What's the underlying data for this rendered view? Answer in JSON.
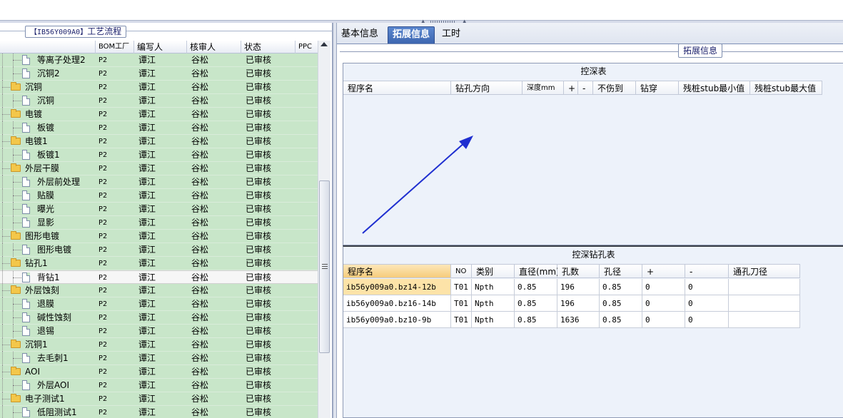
{
  "left_panel": {
    "title_code": "【IB56Y009A0】",
    "title_text": "工艺流程",
    "columns": [
      "BOM工厂",
      "编写人",
      "核审人",
      "状态",
      "PPC"
    ],
    "rows": [
      {
        "name": "等离子处理2",
        "type": "doc",
        "bom": "P2",
        "writer": "谭江",
        "reviewer": "谷松",
        "status": "已审核"
      },
      {
        "name": "沉铜2",
        "type": "doc",
        "bom": "P2",
        "writer": "谭江",
        "reviewer": "谷松",
        "status": "已审核"
      },
      {
        "name": "沉铜",
        "type": "folder",
        "bom": "P2",
        "writer": "谭江",
        "reviewer": "谷松",
        "status": "已审核"
      },
      {
        "name": "沉铜",
        "type": "doc",
        "bom": "P2",
        "writer": "谭江",
        "reviewer": "谷松",
        "status": "已审核"
      },
      {
        "name": "电镀",
        "type": "folder",
        "bom": "P2",
        "writer": "谭江",
        "reviewer": "谷松",
        "status": "已审核"
      },
      {
        "name": "板镀",
        "type": "doc",
        "bom": "P2",
        "writer": "谭江",
        "reviewer": "谷松",
        "status": "已审核"
      },
      {
        "name": "电镀1",
        "type": "folder",
        "bom": "P2",
        "writer": "谭江",
        "reviewer": "谷松",
        "status": "已审核"
      },
      {
        "name": "板镀1",
        "type": "doc",
        "bom": "P2",
        "writer": "谭江",
        "reviewer": "谷松",
        "status": "已审核"
      },
      {
        "name": "外层干膜",
        "type": "folder",
        "bom": "P2",
        "writer": "谭江",
        "reviewer": "谷松",
        "status": "已审核"
      },
      {
        "name": "外层前处理",
        "type": "doc",
        "bom": "P2",
        "writer": "谭江",
        "reviewer": "谷松",
        "status": "已审核"
      },
      {
        "name": "贴膜",
        "type": "doc",
        "bom": "P2",
        "writer": "谭江",
        "reviewer": "谷松",
        "status": "已审核"
      },
      {
        "name": "曝光",
        "type": "doc",
        "bom": "P2",
        "writer": "谭江",
        "reviewer": "谷松",
        "status": "已审核"
      },
      {
        "name": "显影",
        "type": "doc",
        "bom": "P2",
        "writer": "谭江",
        "reviewer": "谷松",
        "status": "已审核"
      },
      {
        "name": "图形电镀",
        "type": "folder",
        "bom": "P2",
        "writer": "谭江",
        "reviewer": "谷松",
        "status": "已审核"
      },
      {
        "name": "图形电镀",
        "type": "doc",
        "bom": "P2",
        "writer": "谭江",
        "reviewer": "谷松",
        "status": "已审核"
      },
      {
        "name": "钻孔1",
        "type": "folder",
        "bom": "P2",
        "writer": "谭江",
        "reviewer": "谷松",
        "status": "已审核"
      },
      {
        "name": "背钻1",
        "type": "doc",
        "bom": "P2",
        "writer": "谭江",
        "reviewer": "谷松",
        "status": "已审核",
        "selected": true
      },
      {
        "name": "外层蚀刻",
        "type": "folder",
        "bom": "P2",
        "writer": "谭江",
        "reviewer": "谷松",
        "status": "已审核"
      },
      {
        "name": "退膜",
        "type": "doc",
        "bom": "P2",
        "writer": "谭江",
        "reviewer": "谷松",
        "status": "已审核"
      },
      {
        "name": "碱性蚀刻",
        "type": "doc",
        "bom": "P2",
        "writer": "谭江",
        "reviewer": "谷松",
        "status": "已审核"
      },
      {
        "name": "退锡",
        "type": "doc",
        "bom": "P2",
        "writer": "谭江",
        "reviewer": "谷松",
        "status": "已审核"
      },
      {
        "name": "沉铜1",
        "type": "folder",
        "bom": "P2",
        "writer": "谭江",
        "reviewer": "谷松",
        "status": "已审核"
      },
      {
        "name": "去毛刺1",
        "type": "doc",
        "bom": "P2",
        "writer": "谭江",
        "reviewer": "谷松",
        "status": "已审核"
      },
      {
        "name": "AOI",
        "type": "folder",
        "bom": "P2",
        "writer": "谭江",
        "reviewer": "谷松",
        "status": "已审核"
      },
      {
        "name": "外层AOI",
        "type": "doc",
        "bom": "P2",
        "writer": "谭江",
        "reviewer": "谷松",
        "status": "已审核"
      },
      {
        "name": "电子测试1",
        "type": "folder",
        "bom": "P2",
        "writer": "谭江",
        "reviewer": "谷松",
        "status": "已审核"
      },
      {
        "name": "低阻测试1",
        "type": "doc",
        "bom": "P2",
        "writer": "谭江",
        "reviewer": "谷松",
        "status": "已审核"
      }
    ]
  },
  "right_panel": {
    "tabs": [
      "基本信息",
      "拓展信息",
      "工时"
    ],
    "active_tab": "拓展信息",
    "group_title": "拓展信息",
    "depth_table": {
      "title": "控深表",
      "columns": [
        "程序名",
        "钻孔方向",
        "深度mm",
        "+",
        "-",
        "不伤到",
        "钻穿",
        "残桩stub最小值",
        "残桩stub最大值"
      ]
    },
    "drill_table": {
      "title": "控深钻孔表",
      "columns": [
        "程序名",
        "NO",
        "类别",
        "直径(mm)",
        "孔数",
        "孔径",
        "+",
        "-",
        "通孔刀径"
      ],
      "rows": [
        [
          "ib56y009a0.bz14-12b",
          "T01",
          "Npth",
          "0.85",
          "196",
          "0.85",
          "0",
          "0",
          ""
        ],
        [
          "ib56y009a0.bz16-14b",
          "T01",
          "Npth",
          "0.85",
          "196",
          "0.85",
          "0",
          "0",
          ""
        ],
        [
          "ib56y009a0.bz10-9b",
          "T01",
          "Npth",
          "0.85",
          "1636",
          "0.85",
          "0",
          "0",
          ""
        ]
      ]
    }
  },
  "colors": {
    "row_green": "#c8e6c9",
    "active_tab": "#4a74bd",
    "arrow": "#1f2fd0",
    "highlight": "#fde3a8"
  }
}
